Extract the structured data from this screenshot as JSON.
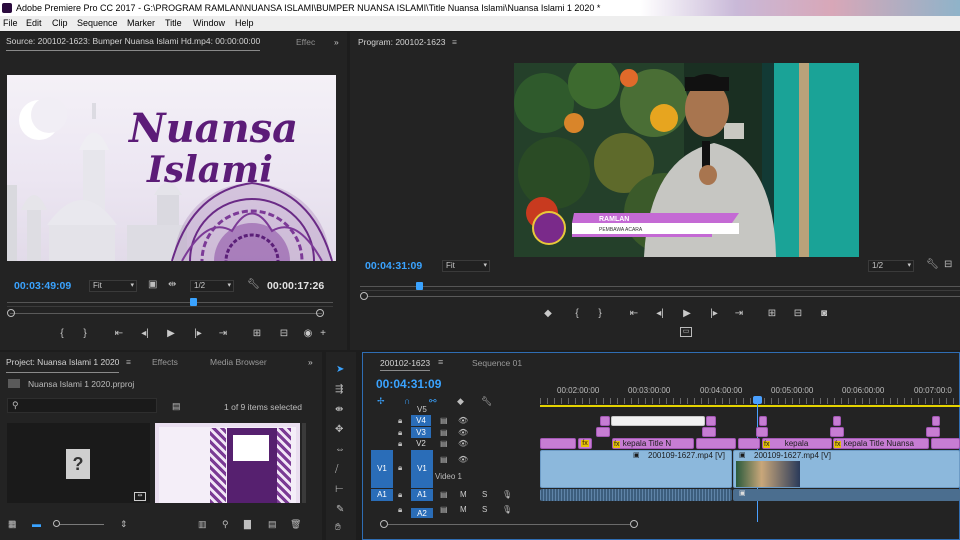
{
  "app": {
    "title": "Adobe Premiere Pro CC 2017 - G:\\PROGRAM RAMLAN\\NUANSA ISLAMI\\BUMPER NUANSA ISLAMI\\Title Nuansa Islami\\Nuansa Islami 1 2020 *"
  },
  "menu": [
    "File",
    "Edit",
    "Clip",
    "Sequence",
    "Marker",
    "Title",
    "Window",
    "Help"
  ],
  "source": {
    "tab": "Source: 200102-1623: Bumper Nuansa Islami Hd.mp4: 00:00:00:00",
    "tab2": "Effec",
    "timecode": "00:03:49:09",
    "fit": "Fit",
    "resolution": "1/2",
    "duration": "00:00:17:26",
    "title_line1": "Nuansa",
    "title_line2": "Islami"
  },
  "program": {
    "tab": "Program: 200102-1623",
    "timecode": "00:04:31:09",
    "fit": "Fit",
    "resolution": "1/2",
    "lower_third_name": "RAMLAN",
    "lower_third_role": "PEMBAWA ACARA"
  },
  "project": {
    "tabs": [
      "Project: Nuansa Islami 1 2020",
      "Effects",
      "Media Browser"
    ],
    "file": "Nuansa Islami 1 2020.prproj",
    "items_selected": "1 of 9 items selected"
  },
  "timeline": {
    "tabs": [
      "200102-1623",
      "Sequence 01"
    ],
    "timecode": "00:04:31:09",
    "ruler": [
      "00:02:00:00",
      "00:03:00:00",
      "00:04:00:00",
      "00:05:00:00",
      "00:06:00:00",
      "00:07:00:0"
    ],
    "tracks": {
      "v5": "V5",
      "v4": "V4",
      "v3": "V3",
      "v2": "V2",
      "v1_src": "V1",
      "v1": "V1",
      "video1": "Video 1",
      "a1_src": "A1",
      "a1": "A1",
      "a2": "A2",
      "m": "M",
      "s": "S"
    },
    "clips": {
      "title1": "kepala Title N",
      "title2": "kepala",
      "title3": "kepala Title Nuansa",
      "video1": "200109-1627.mp4 [V]",
      "video2": "200109-1627.mp4 [V]",
      "fx": "fx"
    }
  },
  "colors": {
    "accent_blue": "#3aa3ff",
    "clip_pink": "#c77dd3",
    "clip_blue": "#8cb8dc",
    "playhead": "#4aa0ff",
    "work_area": "#e4d300"
  }
}
